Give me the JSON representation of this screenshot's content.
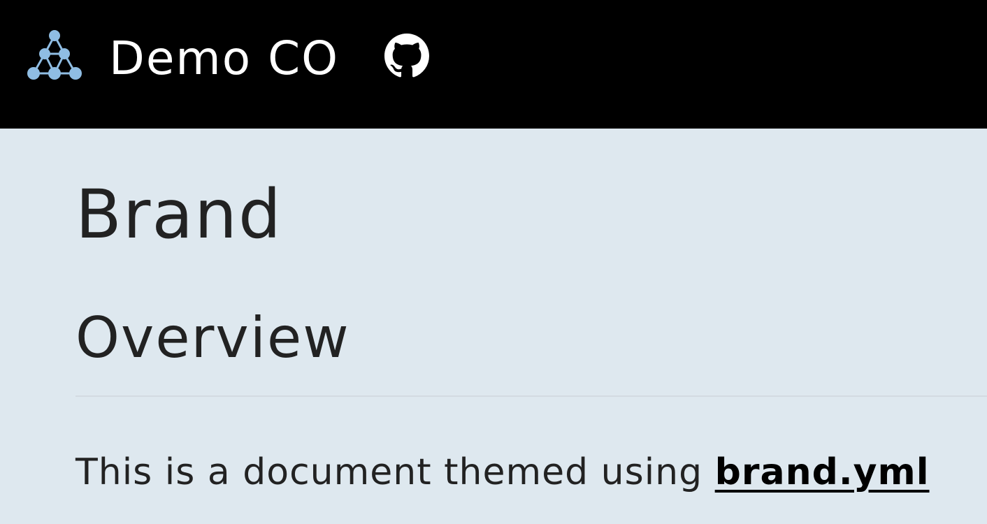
{
  "navbar": {
    "brand_name": "Demo CO",
    "logo_icon": "network-nodes-icon",
    "github_icon": "github-icon",
    "background_color": "#000000",
    "logo_color": "#8fbde3"
  },
  "page": {
    "title": "Brand",
    "section_heading": "Overview",
    "intro_text": "This is a document themed using ",
    "intro_link": "brand.yml",
    "background_color": "#dee8ef",
    "text_color": "#222222"
  }
}
